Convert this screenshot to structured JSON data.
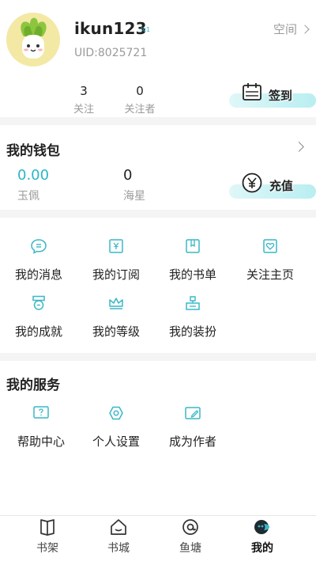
{
  "profile": {
    "username": "ikun123",
    "level_badge": "lv1",
    "uid": "UID:8025721",
    "space_label": "空间",
    "stats": [
      {
        "value": "3",
        "label": "关注"
      },
      {
        "value": "0",
        "label": "关注者"
      }
    ],
    "checkin_label": "签到"
  },
  "wallet": {
    "title": "我的钱包",
    "items": [
      {
        "value": "0.00",
        "label": "玉佩"
      },
      {
        "value": "0",
        "label": "海星"
      }
    ],
    "recharge_label": "充值"
  },
  "features": {
    "items": [
      {
        "label": "我的消息",
        "icon": "message-icon"
      },
      {
        "label": "我的订阅",
        "icon": "subscription-icon"
      },
      {
        "label": "我的书单",
        "icon": "booklist-icon"
      },
      {
        "label": "关注主页",
        "icon": "follow-home-icon"
      },
      {
        "label": "我的成就",
        "icon": "medal-icon"
      },
      {
        "label": "我的等级",
        "icon": "crown-icon"
      },
      {
        "label": "我的装扮",
        "icon": "dressup-icon"
      }
    ]
  },
  "services": {
    "title": "我的服务",
    "items": [
      {
        "label": "帮助中心",
        "icon": "help-icon"
      },
      {
        "label": "个人设置",
        "icon": "settings-icon"
      },
      {
        "label": "成为作者",
        "icon": "author-icon"
      }
    ]
  },
  "tabbar": {
    "items": [
      {
        "label": "书架",
        "icon": "bookshelf-icon"
      },
      {
        "label": "书城",
        "icon": "bookstore-icon"
      },
      {
        "label": "鱼塘",
        "icon": "fishpond-icon"
      },
      {
        "label": "我的",
        "icon": "me-icon"
      }
    ],
    "active": "我的"
  },
  "colors": {
    "accent": "#3ab7c7",
    "wallet_value": "#2bb6c6",
    "divider": "#f4f4f4"
  }
}
